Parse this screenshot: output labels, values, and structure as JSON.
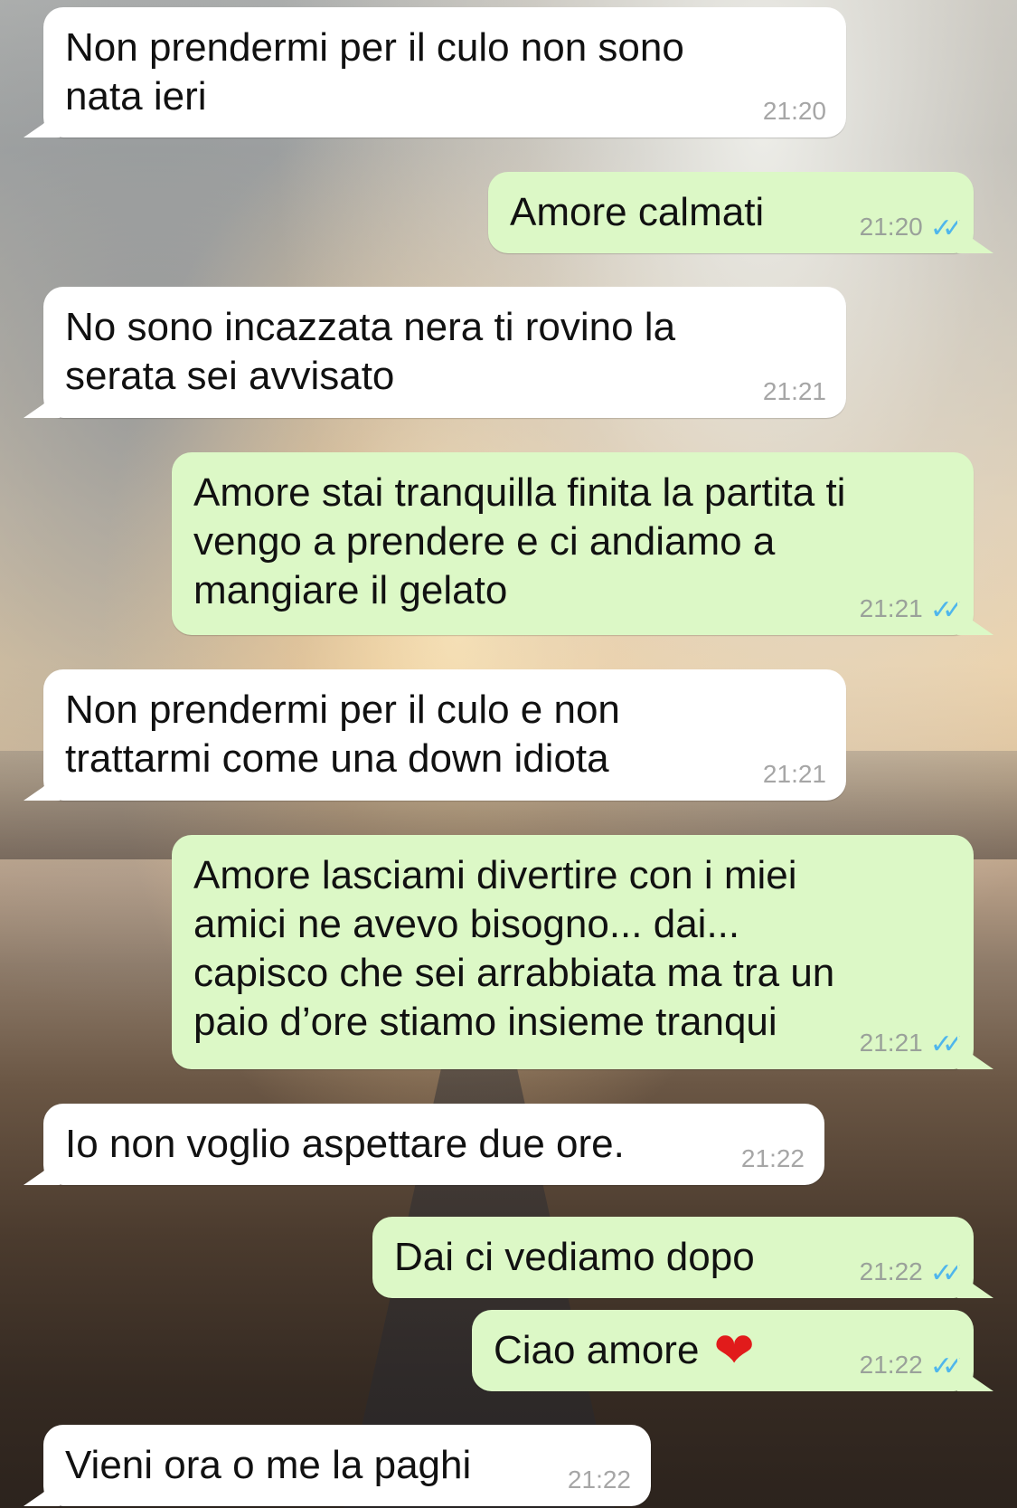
{
  "messages": [
    {
      "direction": "in",
      "text": "Non prendermi per il culo non sono\nnata ieri",
      "time": "21:20"
    },
    {
      "direction": "out",
      "text": "Amore calmati",
      "time": "21:20",
      "status_icon": "double-check-icon"
    },
    {
      "direction": "in",
      "text": "No sono incazzata nera ti rovino la\nserata sei avvisato",
      "time": "21:21"
    },
    {
      "direction": "out",
      "text": "Amore stai tranquilla finita la partita ti\nvengo a prendere e ci andiamo a\nmangiare il gelato",
      "time": "21:21",
      "status_icon": "double-check-icon"
    },
    {
      "direction": "in",
      "text": "Non prendermi per il culo e non\ntrattarmi come una down idiota",
      "time": "21:21"
    },
    {
      "direction": "out",
      "text": "Amore lasciami divertire con i miei\namici ne avevo bisogno... dai...\ncapisco che sei arrabbiata ma tra un\npaio d’ore stiamo insieme tranqui",
      "time": "21:21",
      "status_icon": "double-check-icon"
    },
    {
      "direction": "in",
      "text": "Io non voglio aspettare due ore.",
      "time": "21:22"
    },
    {
      "direction": "out",
      "text": "Dai ci vediamo dopo",
      "time": "21:22",
      "status_icon": "double-check-icon"
    },
    {
      "direction": "out",
      "text": "Ciao amore",
      "emoji": "❤",
      "time": "21:22",
      "status_icon": "double-check-icon"
    },
    {
      "direction": "in",
      "text": "Vieni ora o me la paghi",
      "time": "21:22"
    }
  ],
  "colors": {
    "incoming_bubble": "#ffffff",
    "outgoing_bubble": "#dcf8c6",
    "read_ticks": "#4fb6ec"
  }
}
